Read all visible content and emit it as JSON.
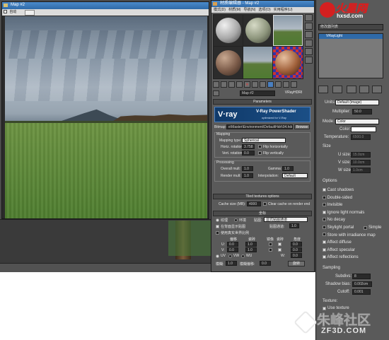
{
  "map_window": {
    "title": "Map #2",
    "toolbar_label": "自动",
    "toolbar_check": "✓"
  },
  "mat_editor": {
    "title": "材质编辑器 - Map #2",
    "menu": [
      "模式(D)",
      "材质(M)",
      "导航(N)",
      "选项(O)",
      "实用程序(U)"
    ],
    "map_name": "Map #2",
    "map_type": "VRayHDRI"
  },
  "parameters": {
    "rollout_title": "Parameters",
    "vray_banner": "V-Ray PowerShader",
    "vray_sub": "optimized for V-Ray",
    "vray_logo": "V·ray",
    "bitmap_label": "Bitmap:",
    "bitmap_path": "e\\Master\\Environment\\DefaultHdri\\04.hdr",
    "browse": "Browse",
    "mapping_label": "Mapping",
    "mapping_type_label": "Mapping type:",
    "mapping_type_value": "Spherical",
    "horiz_rot_label": "Horiz. rotation:",
    "horiz_rot_value": "3.758",
    "flip_h": "Flip horizontally",
    "vert_rot_label": "Vert. rotation:",
    "vert_rot_value": "0.0",
    "flip_v": "Flip vertically",
    "processing_label": "Processing",
    "overall_mult_label": "Overall mult:",
    "overall_mult_value": "1.0",
    "gamma_label": "Gamma:",
    "gamma_value": "1.0",
    "render_mult_label": "Render mult:",
    "render_mult_value": "1.0",
    "interp_label": "Interpolation:",
    "interp_value": "Default",
    "tiled_title": "Tiled textures options",
    "cache_label": "Cache size (MB):",
    "cache_value": "4000",
    "clear_cache": "Clear cache on render end"
  },
  "coords": {
    "title": "坐标",
    "texture": "纹理",
    "env": "环境",
    "mapping_label": "贴图:",
    "mapping_value": "显式贴图通道",
    "show_back": "在背面显示贴图",
    "map_channel": "贴图通道:",
    "use_real": "使用真实世界比例",
    "offset": "偏移",
    "tiling": "瓷砖",
    "mirror": "镜像",
    "tile": "瓷砖",
    "angle": "角度",
    "u": "U:",
    "v": "V:",
    "w": "W:",
    "uv": "UV",
    "vw": "VW",
    "wu": "WU",
    "blur": "模糊:",
    "blur_offset": "模糊偏移:",
    "rotate": "旋转",
    "zero": "0.0",
    "one": "1.0",
    "blur_val": "1.0",
    "blur_off_val": "0.0"
  },
  "right_panel": {
    "browser_label": "修改器列表",
    "stack_item": "VRayLight",
    "units_label": "Units:",
    "units_value": "Default (image)",
    "multiplier_label": "Multiplier:",
    "multiplier_value": "50.0",
    "mode_label": "Mode:",
    "mode_value": "Color",
    "color_label": "Color:",
    "temp_label": "Temperature:",
    "temp_value": "6500.0",
    "size_label": "Size",
    "u_size_label": "U size:",
    "u_size_value": "15.0cm",
    "v_size_label": "V size:",
    "v_size_value": "10.0cm",
    "w_size_label": "W size:",
    "w_size_value": "1.0cm",
    "options_label": "Options",
    "options": [
      {
        "label": "Cast shadows",
        "checked": true
      },
      {
        "label": "Double-sided",
        "checked": false
      },
      {
        "label": "Invisible",
        "checked": false
      },
      {
        "label": "Ignore light normals",
        "checked": true
      },
      {
        "label": "No decay",
        "checked": false
      },
      {
        "label": "Skylight portal",
        "checked": false
      },
      {
        "label": "Store with irradiance map",
        "checked": false
      },
      {
        "label": "Affect diffuse",
        "checked": true
      },
      {
        "label": "Affect specular",
        "checked": true
      },
      {
        "label": "Affect reflections",
        "checked": true
      }
    ],
    "simple_label": "Simple",
    "sampling_label": "Sampling",
    "subdivs_label": "Subdivs:",
    "subdivs_value": "8",
    "shadow_bias_label": "Shadow bias:",
    "shadow_bias_value": "0.002cm",
    "cutoff_label": "Cutoff:",
    "cutoff_value": "0.001",
    "texture_label": "Texture:",
    "use_texture_label": "Use texture"
  },
  "watermark_top": {
    "logo": "火星网",
    "url": "hxsd.com"
  },
  "watermark_bottom": {
    "logo": "朱峰社区",
    "url": "ZF3D.COM"
  },
  "colors": {
    "accent": "#2f6aa8",
    "panel": "#5a5a5a",
    "banner": "#1b4f86"
  }
}
